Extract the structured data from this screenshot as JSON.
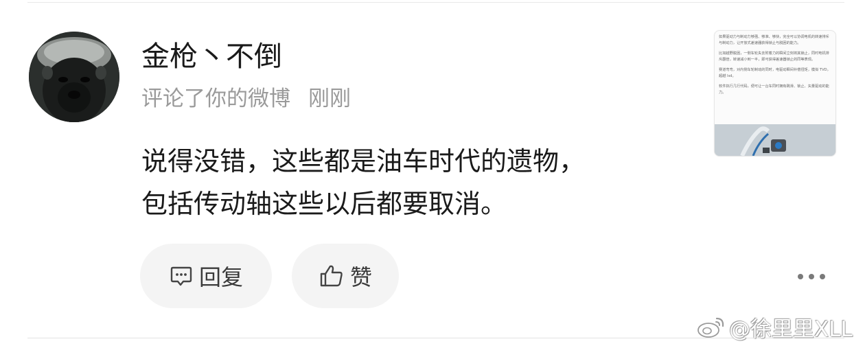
{
  "comment_notification": {
    "username": "金枪丶不倒",
    "action_text": "评论了你的微博",
    "time": "刚刚",
    "comment_lines": [
      "说得没错，这些都是油车时代的遗物，",
      "包括传动轴这些以后都要取消。"
    ],
    "avatar_icon": "honey-badger-avatar"
  },
  "actions": {
    "reply_label": "回复",
    "reply_icon": "comment-bubble-icon",
    "like_label": "赞",
    "like_icon": "thumbs-up-icon",
    "more_icon": "more-dots-icon"
  },
  "thumbnail": {
    "paragraphs": [
      "如果驱动力与制动力够强、够准、够快，完全可以协调电机的转速排斥与制动力，让开放式差速器获得锁止与脱困的能力。",
      "比如越野脱困，一侧车轮失去附着力的瞬间立刻将其锁止，同时电机排斥翻倍，转速减小到一半，即可获得差速器锁止的同等表现。",
      "赛道弯弯，对内侧车轮制动的同时，电驱动瞬间补偿扭矩，模拟 TVD，超越 lsd。",
      "软件执行几行代码，便可让一台车同时拥有跳滑、锁止、矢量驱动的能力。"
    ]
  },
  "watermark": {
    "text": "@徐里里XLL",
    "icon": "weibo-logo-icon"
  },
  "colors": {
    "text_primary": "#1a1a1a",
    "text_secondary": "#9a9a9a",
    "pill_background": "#f4f4f4",
    "divider": "#e9e9e9"
  }
}
